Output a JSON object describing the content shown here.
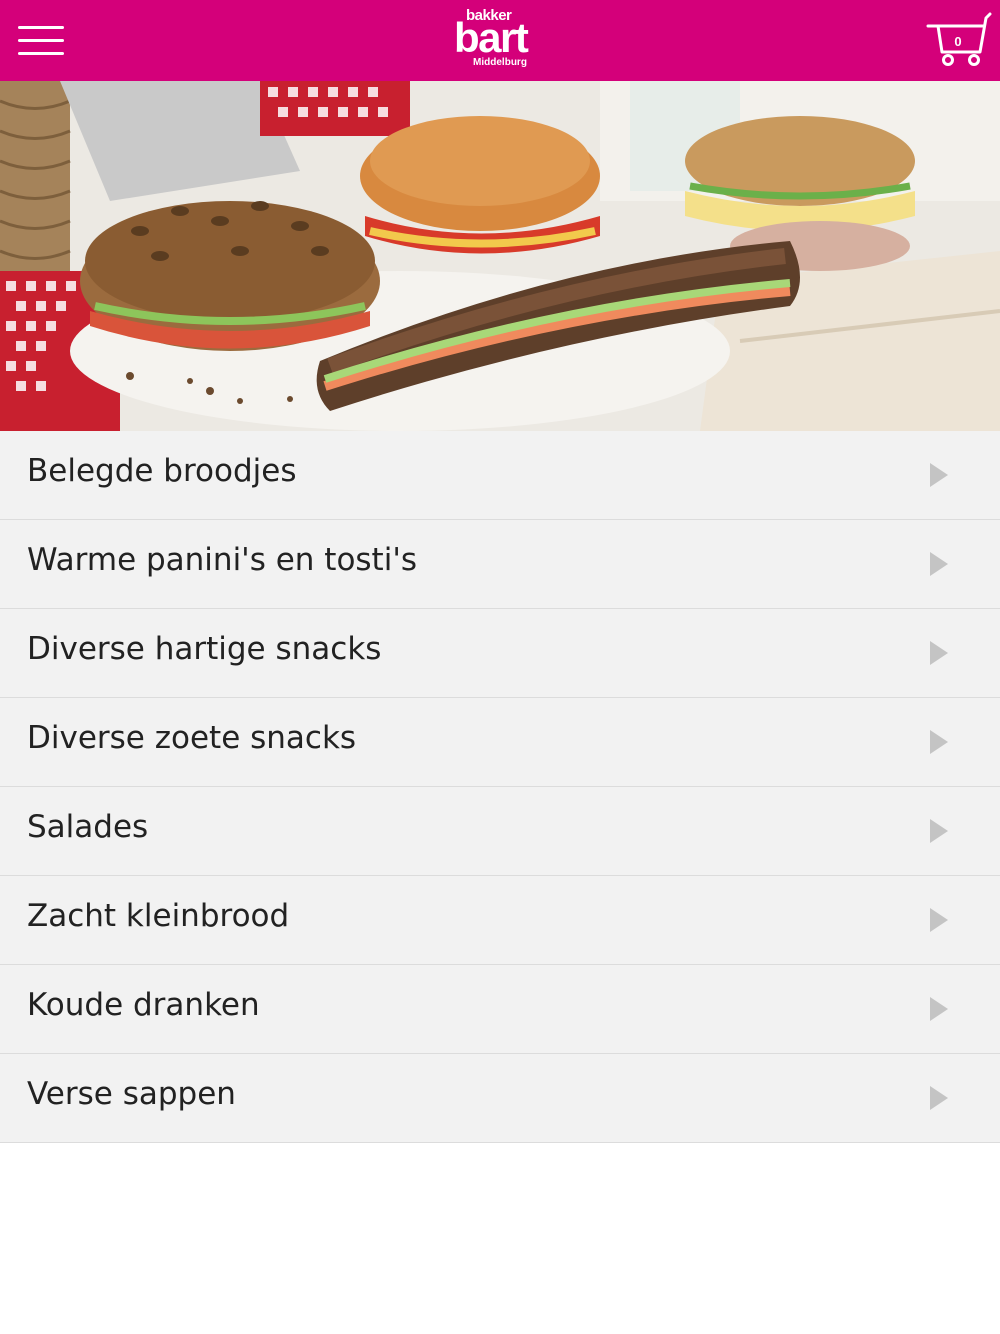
{
  "header": {
    "logo_top": "bakker",
    "logo_main": "bart",
    "logo_sub": "Middelburg",
    "cart_count": "0",
    "background": "#d4007a"
  },
  "hero": {
    "icon": "sandwich-photo"
  },
  "menu": {
    "items": [
      {
        "label": "Belegde broodjes"
      },
      {
        "label": "Warme panini's en tosti's"
      },
      {
        "label": "Diverse hartige snacks"
      },
      {
        "label": "Diverse zoete snacks"
      },
      {
        "label": "Salades"
      },
      {
        "label": "Zacht kleinbrood"
      },
      {
        "label": "Koude dranken"
      },
      {
        "label": "Verse sappen"
      }
    ]
  }
}
